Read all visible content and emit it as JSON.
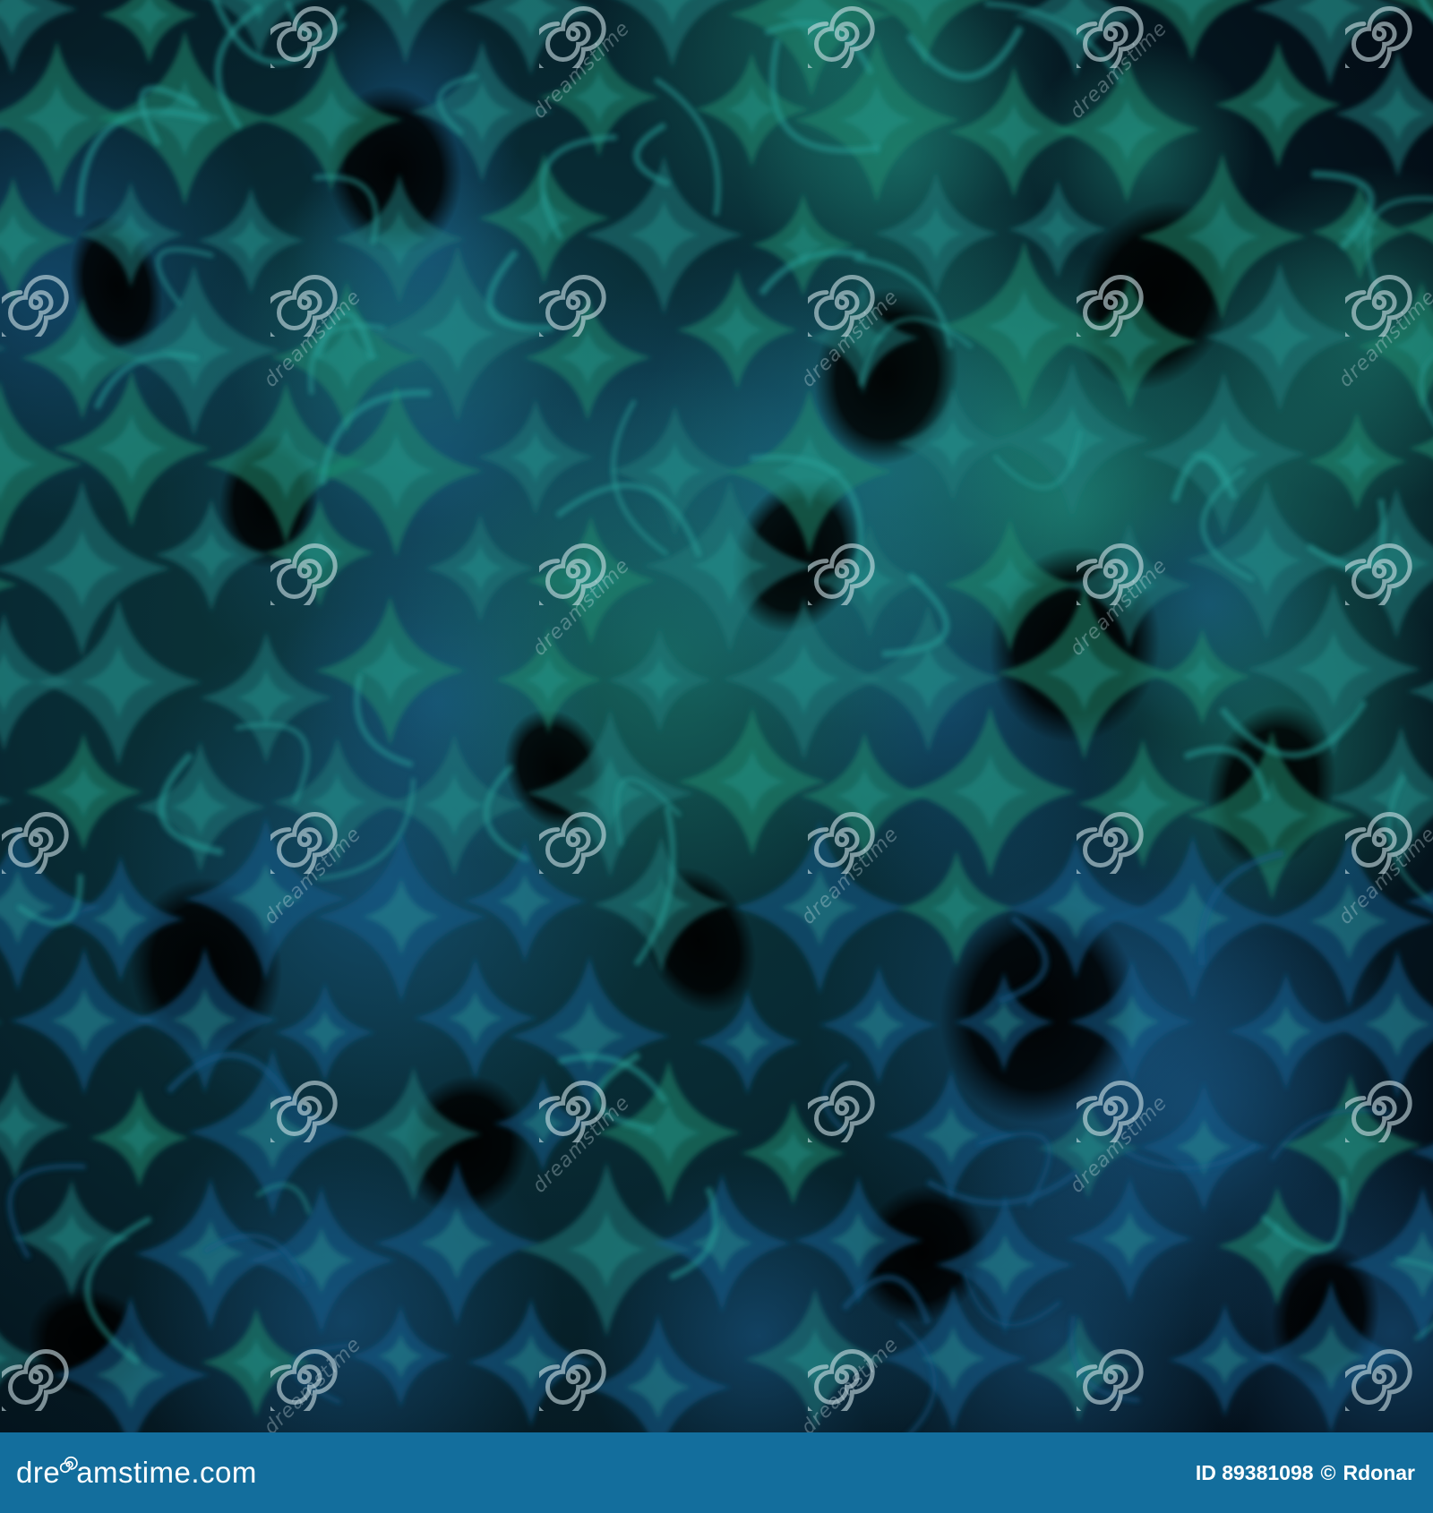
{
  "image": {
    "subject": "abstract fractal pattern",
    "palette": {
      "deep": "#02060a",
      "teal": "#1f7a7a",
      "green_teal": "#1d8a6e",
      "blue": "#1a5c8a",
      "glow": "#2aa39a"
    },
    "shapes": [
      "four-pointed star",
      "leaf ellipse",
      "arc petal"
    ]
  },
  "watermark": {
    "text": "dreamstime",
    "icon": "spiral-icon",
    "color": "#cde1e6"
  },
  "footer": {
    "brand_prefix": "dre",
    "brand_suffix": "amstime.com",
    "image_id": "ID 89381098",
    "copyright_symbol": "©",
    "author": "Rdonar",
    "bar_color": "#136e9d"
  }
}
